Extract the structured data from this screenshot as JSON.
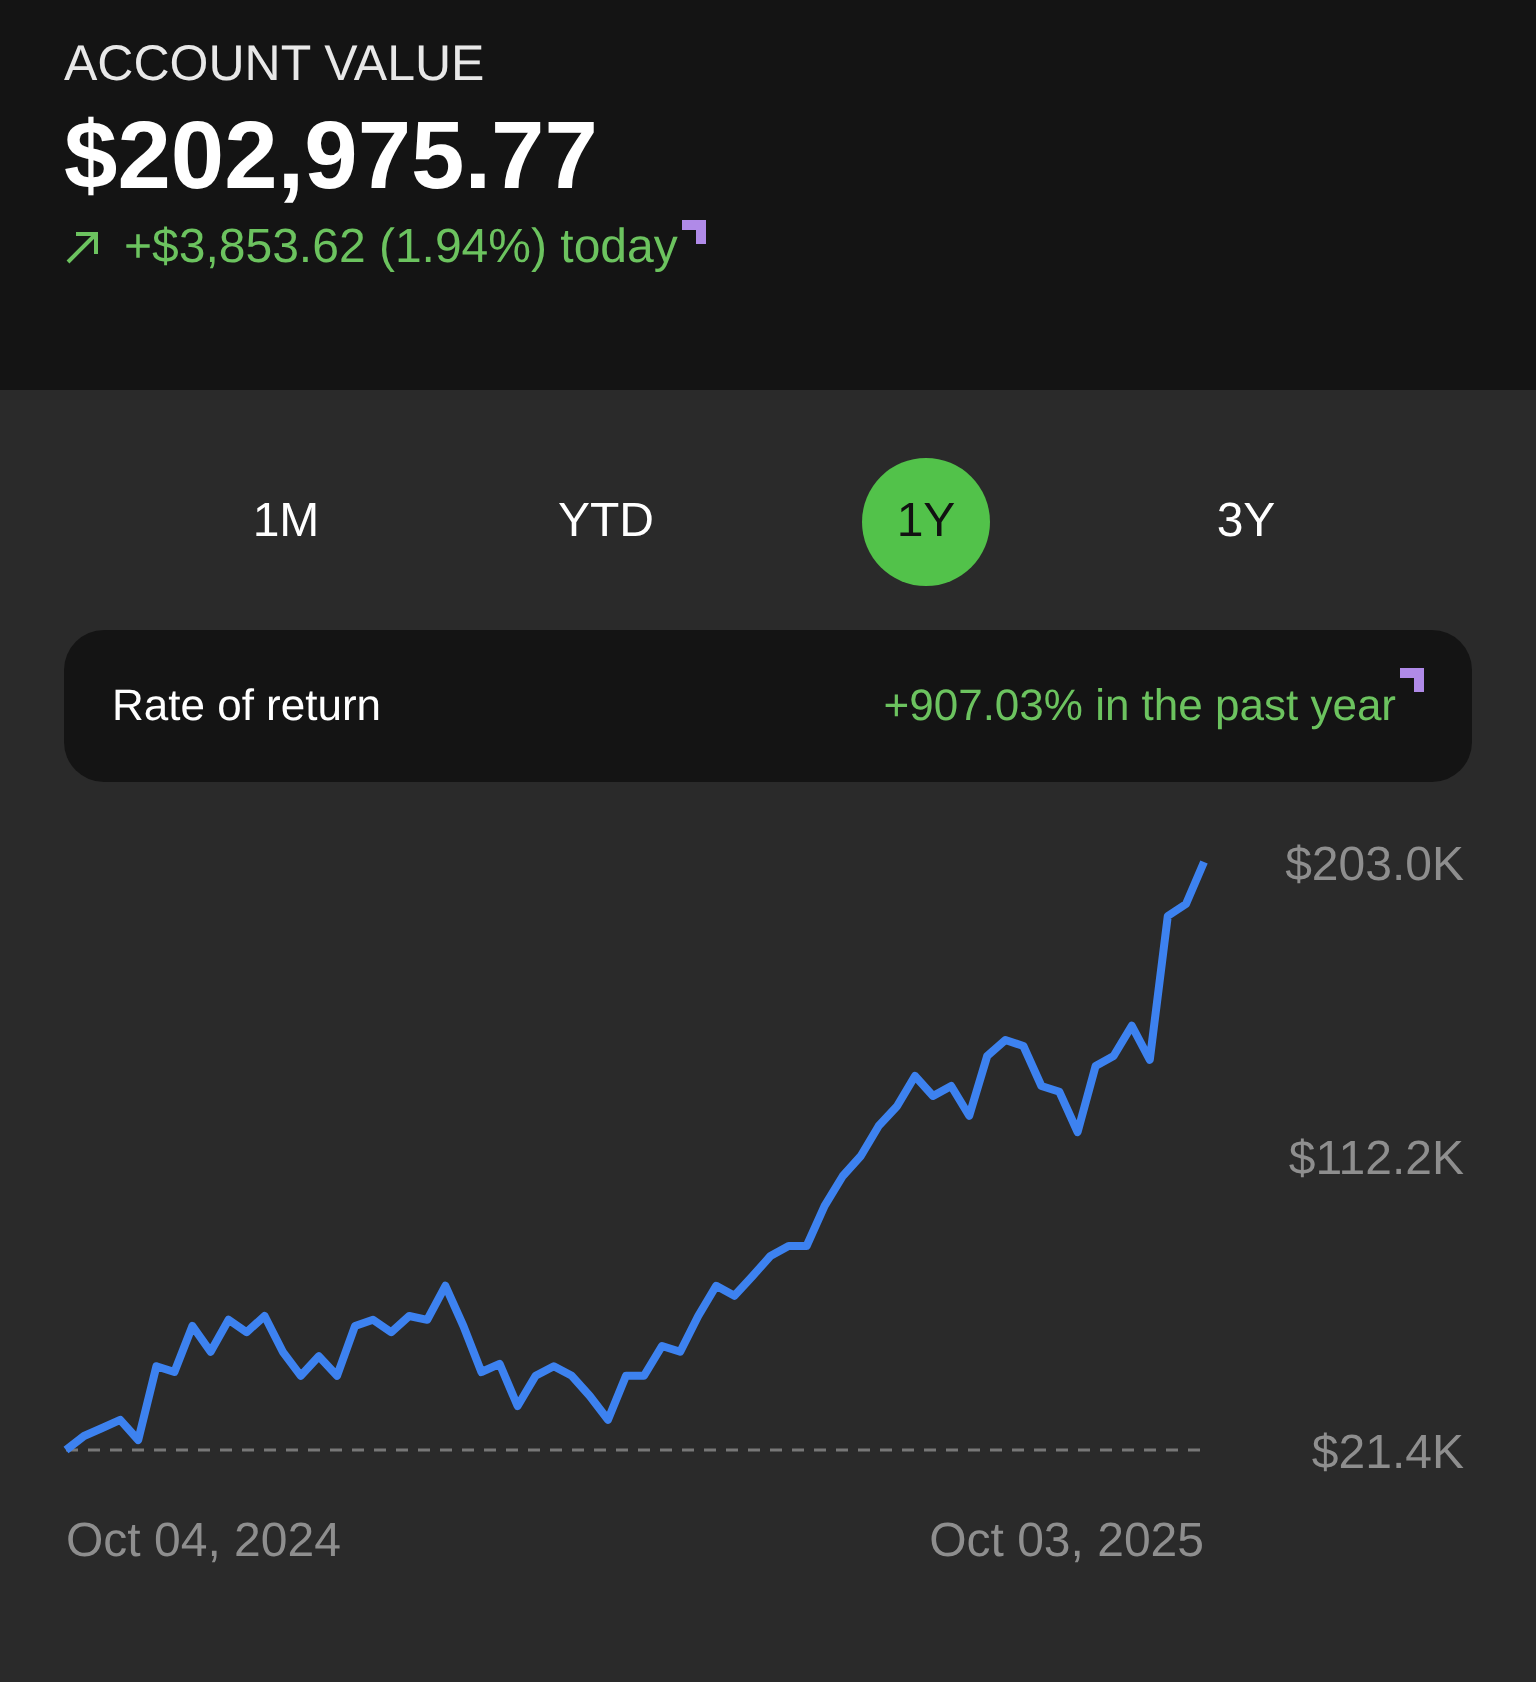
{
  "header": {
    "title": "ACCOUNT VALUE",
    "value": "$202,975.77",
    "change": "+$3,853.62 (1.94%) today"
  },
  "tabs": [
    {
      "label": "1M",
      "selected": false
    },
    {
      "label": "YTD",
      "selected": false
    },
    {
      "label": "1Y",
      "selected": true
    },
    {
      "label": "3Y",
      "selected": false
    }
  ],
  "rate_of_return": {
    "label": "Rate of return",
    "value": "+907.03% in the past year"
  },
  "chart": {
    "start_date": "Oct 04, 2024",
    "end_date": "Oct 03, 2025",
    "chart_data": {
      "type": "line",
      "ylim": [
        21.4,
        203.0
      ],
      "yticks": [
        {
          "value": 203.0,
          "label": "$203.0K"
        },
        {
          "value": 112.2,
          "label": "$112.2K"
        },
        {
          "value": 21.4,
          "label": "$21.4K"
        }
      ],
      "series": [
        {
          "color": "#3d82f0",
          "values": [
            21.4,
            25.7,
            28.2,
            30.7,
            24.5,
            47.3,
            45.5,
            59.7,
            51.7,
            61.6,
            57.8,
            62.8,
            51.7,
            44.3,
            50.4,
            44.3,
            59.7,
            61.6,
            57.8,
            62.8,
            61.6,
            72.1,
            59.7,
            45.5,
            48.0,
            35.0,
            44.3,
            47.3,
            44.3,
            38.1,
            30.7,
            44.3,
            44.3,
            53.5,
            51.7,
            62.8,
            72.1,
            69.0,
            75.1,
            81.3,
            84.4,
            84.4,
            96.8,
            106.0,
            112.2,
            121.5,
            127.6,
            136.9,
            130.7,
            133.8,
            124.6,
            143.1,
            148.0,
            146.2,
            133.8,
            132.0,
            119.6,
            140.0,
            143.1,
            152.4,
            141.9,
            186.3,
            190.0,
            203.0
          ]
        }
      ]
    }
  }
}
